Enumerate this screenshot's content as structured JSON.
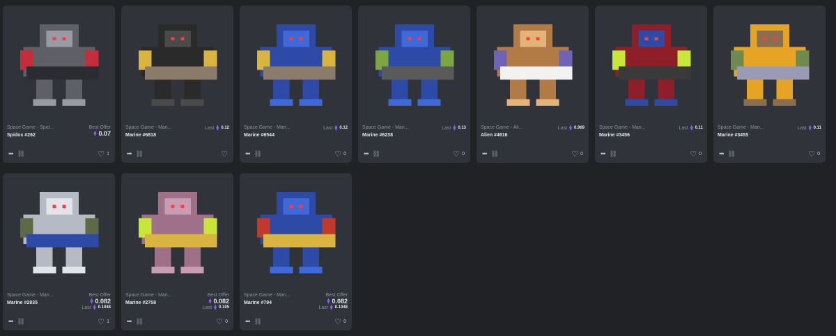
{
  "cards": [
    {
      "collection": "Space Game - Spid...",
      "name": "Spidox #262",
      "price_label": "Best Offer",
      "price_value": "0.07",
      "last_label": "",
      "last_value": "",
      "likes": "1",
      "image_icon": "spider-drone-icon",
      "palette": [
        "#5f5f66",
        "#9a9aa2",
        "#c62c3a",
        "#2b2b32"
      ]
    },
    {
      "collection": "Space Game - Mari...",
      "name": "Marine #6818",
      "price_label": "",
      "price_value": "",
      "last_label": "Last",
      "last_value": "0.12",
      "likes": "",
      "image_icon": "black-marine-icon",
      "palette": [
        "#2a2a2a",
        "#4a4a4a",
        "#d9b441",
        "#8b7b6b"
      ]
    },
    {
      "collection": "Space Game - Mari...",
      "name": "Marine #6544",
      "price_label": "",
      "price_value": "",
      "last_label": "Last",
      "last_value": "0.12",
      "likes": "0",
      "image_icon": "blue-marine-icon",
      "palette": [
        "#2c4aa6",
        "#3f69d8",
        "#d9b441",
        "#8b7b6b"
      ]
    },
    {
      "collection": "Space Game - Mari...",
      "name": "Marine #6238",
      "price_label": "",
      "price_value": "",
      "last_label": "Last",
      "last_value": "0.13",
      "likes": "0",
      "image_icon": "blue-marine-bazooka-icon",
      "palette": [
        "#2c4aa6",
        "#3f69d8",
        "#7ba641",
        "#5a5a5a"
      ]
    },
    {
      "collection": "Space Game - Ali...",
      "name": "Alien #4616",
      "price_label": "",
      "price_value": "",
      "last_label": "Last",
      "last_value": "0.969",
      "likes": "0",
      "image_icon": "alien-creature-icon",
      "palette": [
        "#b27a45",
        "#e4b37a",
        "#6f63b5",
        "#f2f2f2"
      ]
    },
    {
      "collection": "Space Game - Mari...",
      "name": "Marine #3456",
      "price_label": "",
      "price_value": "",
      "last_label": "Last",
      "last_value": "0.11",
      "likes": "0",
      "image_icon": "red-helmet-marine-icon",
      "palette": [
        "#8e1f29",
        "#2c4aa6",
        "#c8e63a",
        "#3a3a3a"
      ]
    },
    {
      "collection": "Space Game - Mari...",
      "name": "Marine #3455",
      "price_label": "",
      "price_value": "",
      "last_label": "Last",
      "last_value": "0.11",
      "likes": "0",
      "image_icon": "gold-marine-icon",
      "palette": [
        "#e6a425",
        "#8b6d4f",
        "#6e8a4f",
        "#9a9ab4"
      ]
    },
    {
      "collection": "Space Game - Mari...",
      "name": "Marine #2835",
      "price_label": "Best Offer",
      "price_value": "0.082",
      "last_label": "Last",
      "last_value": "0.1048",
      "likes": "1",
      "image_icon": "silver-marine-icon",
      "palette": [
        "#b6bac4",
        "#e2e4ea",
        "#5c6b45",
        "#2c4aa6"
      ]
    },
    {
      "collection": "Space Game - Mari...",
      "name": "Marine #2758",
      "price_label": "Best Offer",
      "price_value": "0.082",
      "last_label": "Last",
      "last_value": "0.105",
      "likes": "0",
      "image_icon": "pink-marine-icon",
      "palette": [
        "#a0708a",
        "#c79db3",
        "#c8e63a",
        "#d9b441"
      ]
    },
    {
      "collection": "Space Game - Mari...",
      "name": "Marine #794",
      "price_label": "Best Offer",
      "price_value": "0.082",
      "last_label": "Last",
      "last_value": "0.1048",
      "likes": "0",
      "image_icon": "blue-marine-sword-icon",
      "palette": [
        "#2c4aa6",
        "#3f69d8",
        "#c0392b",
        "#d9b441"
      ]
    }
  ],
  "colors": {
    "background": "#202225",
    "card": "#303339",
    "eth": "#8b5cf6"
  }
}
